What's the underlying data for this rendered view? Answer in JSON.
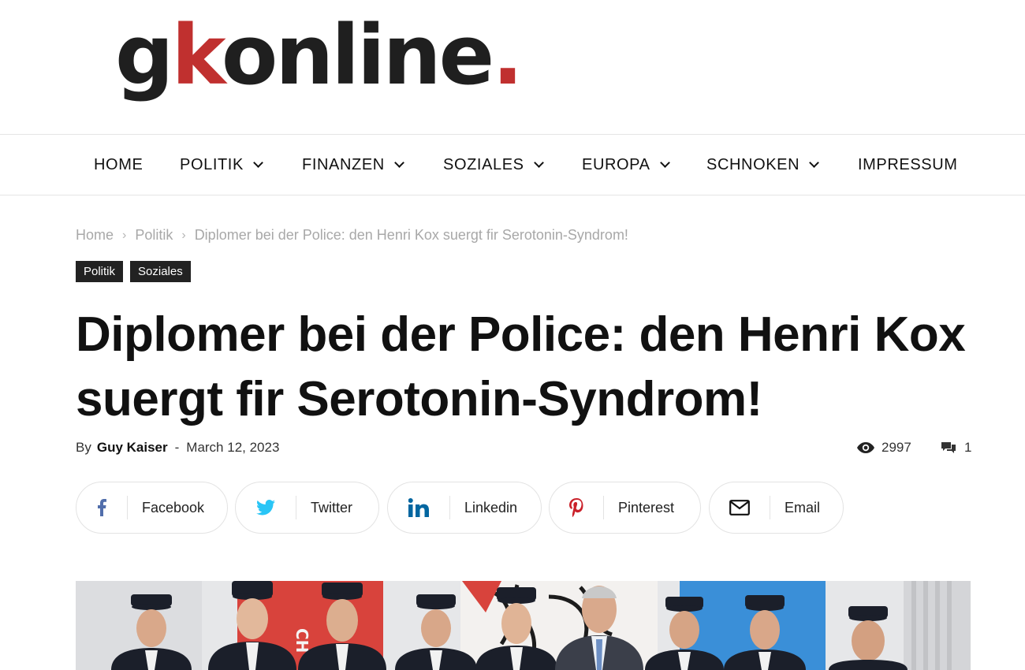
{
  "logo": {
    "part1": "g",
    "part2": "k",
    "part3": "online",
    "part4": "."
  },
  "nav": {
    "items": [
      {
        "label": "HOME",
        "has_dropdown": false
      },
      {
        "label": "POLITIK",
        "has_dropdown": true
      },
      {
        "label": "FINANZEN",
        "has_dropdown": true
      },
      {
        "label": "SOZIALES",
        "has_dropdown": true
      },
      {
        "label": "EUROPA",
        "has_dropdown": true
      },
      {
        "label": "SCHNOKEN",
        "has_dropdown": true
      },
      {
        "label": "IMPRESSUM",
        "has_dropdown": false
      }
    ]
  },
  "breadcrumb": {
    "home": "Home",
    "category": "Politik",
    "current": "Diplomer bei der Police: den Henri Kox suergt fir Serotonin-Syndrom!",
    "separator": "›"
  },
  "tags": [
    "Politik",
    "Soziales"
  ],
  "article": {
    "title": "Diplomer bei der Police: den Henri Kox suergt fir Serotonin-Syndrom!",
    "by": "By",
    "author": "Guy Kaiser",
    "dash": "-",
    "date": "March 12, 2023",
    "views": "2997",
    "comments": "1"
  },
  "share": [
    {
      "label": "Facebook",
      "icon": "facebook-icon",
      "color": "#516eab"
    },
    {
      "label": "Twitter",
      "icon": "twitter-icon",
      "color": "#29c5f6"
    },
    {
      "label": "Linkedin",
      "icon": "linkedin-icon",
      "color": "#0266a0"
    },
    {
      "label": "Pinterest",
      "icon": "pinterest-icon",
      "color": "#ca212a"
    },
    {
      "label": "Email",
      "icon": "email-icon",
      "color": "#111111"
    }
  ],
  "colors": {
    "accent": "#c0302f",
    "tag_bg": "#222222",
    "breadcrumb": "#a8a8a8"
  }
}
